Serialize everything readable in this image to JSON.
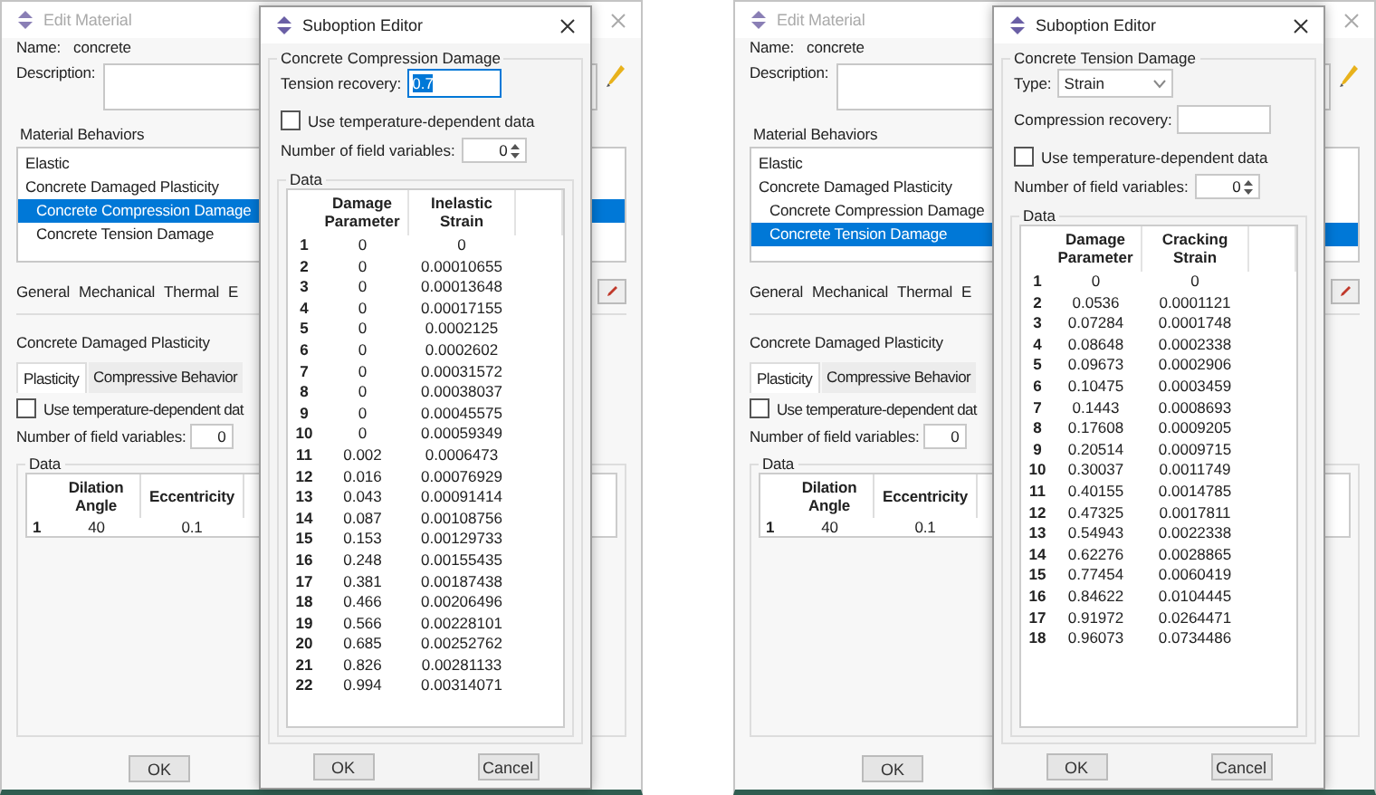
{
  "panels": [
    {
      "edit_material": {
        "title": "Edit Material",
        "name_label": "Name:",
        "name": "concrete",
        "description_label": "Description:",
        "behaviors_label": "Material Behaviors",
        "behaviors": [
          {
            "label": "Elastic",
            "selected": false
          },
          {
            "label": "Concrete Damaged Plasticity",
            "selected": false,
            "children": [
              {
                "label": "Concrete Compression Damage",
                "selected": true
              },
              {
                "label": "Concrete Tension Damage",
                "selected": false
              }
            ]
          }
        ],
        "menus": [
          "General",
          "Mechanical",
          "Thermal",
          "E"
        ],
        "section_title": "Concrete Damaged Plasticity",
        "tabs": [
          {
            "label": "Plasticity",
            "selected": true
          },
          {
            "label": "Compressive Behavior",
            "selected": false
          }
        ],
        "temp_dependent": {
          "label": "Use temperature-dependent dat",
          "checked": false
        },
        "field_vars": {
          "label": "Number of field variables:",
          "value": "0"
        },
        "data_label": "Data",
        "table": {
          "columns": [
            "",
            "Dilation Angle",
            "Eccentricity"
          ],
          "rows": [
            [
              "1",
              "40",
              "0.1"
            ]
          ]
        },
        "buttons": [
          "OK"
        ]
      },
      "suboption_editor": {
        "title": "Suboption Editor",
        "group_title": "Concrete Compression Damage",
        "fields": [
          {
            "kind": "input",
            "label": "Tension recovery:",
            "value": "0.7",
            "value_selected": true
          }
        ],
        "temp_dependent": {
          "label": "Use temperature-dependent data",
          "checked": false
        },
        "field_vars": {
          "label": "Number of field variables:",
          "value": "0"
        },
        "data_label": "Data",
        "table": {
          "columns": [
            "",
            "Damage Parameter",
            "Inelastic Strain"
          ],
          "rows": [
            [
              "1",
              "0",
              "0"
            ],
            [
              "2",
              "0",
              "0.00010655"
            ],
            [
              "3",
              "0",
              "0.00013648"
            ],
            [
              "4",
              "0",
              "0.00017155"
            ],
            [
              "5",
              "0",
              "0.0002125"
            ],
            [
              "6",
              "0",
              "0.0002602"
            ],
            [
              "7",
              "0",
              "0.00031572"
            ],
            [
              "8",
              "0",
              "0.00038037"
            ],
            [
              "9",
              "0",
              "0.00045575"
            ],
            [
              "10",
              "0",
              "0.00059349"
            ],
            [
              "11",
              "0.002",
              "0.0006473"
            ],
            [
              "12",
              "0.016",
              "0.00076929"
            ],
            [
              "13",
              "0.043",
              "0.00091414"
            ],
            [
              "14",
              "0.087",
              "0.00108756"
            ],
            [
              "15",
              "0.153",
              "0.00129733"
            ],
            [
              "16",
              "0.248",
              "0.00155435"
            ],
            [
              "17",
              "0.381",
              "0.00187438"
            ],
            [
              "18",
              "0.466",
              "0.00206496"
            ],
            [
              "19",
              "0.566",
              "0.00228101"
            ],
            [
              "20",
              "0.685",
              "0.00252762"
            ],
            [
              "21",
              "0.826",
              "0.00281133"
            ],
            [
              "22",
              "0.994",
              "0.00314071"
            ]
          ]
        },
        "buttons": [
          "OK",
          "Cancel"
        ]
      }
    },
    {
      "edit_material": {
        "title": "Edit Material",
        "name_label": "Name:",
        "name": "concrete",
        "description_label": "Description:",
        "behaviors_label": "Material Behaviors",
        "behaviors": [
          {
            "label": "Elastic",
            "selected": false
          },
          {
            "label": "Concrete Damaged Plasticity",
            "selected": false,
            "children": [
              {
                "label": "Concrete Compression Damage",
                "selected": false
              },
              {
                "label": "Concrete Tension Damage",
                "selected": true
              }
            ]
          }
        ],
        "menus": [
          "General",
          "Mechanical",
          "Thermal",
          "E"
        ],
        "section_title": "Concrete Damaged Plasticity",
        "tabs": [
          {
            "label": "Plasticity",
            "selected": true
          },
          {
            "label": "Compressive Behavior",
            "selected": false
          }
        ],
        "temp_dependent": {
          "label": "Use temperature-dependent dat",
          "checked": false
        },
        "field_vars": {
          "label": "Number of field variables:",
          "value": "0"
        },
        "data_label": "Data",
        "table": {
          "columns": [
            "",
            "Dilation Angle",
            "Eccentricity"
          ],
          "rows": [
            [
              "1",
              "40",
              "0.1"
            ]
          ]
        },
        "buttons": [
          "OK"
        ]
      },
      "suboption_editor": {
        "title": "Suboption Editor",
        "group_title": "Concrete Tension Damage",
        "fields": [
          {
            "kind": "select",
            "label": "Type:",
            "value": "Strain"
          },
          {
            "kind": "input",
            "label": "Compression recovery:"
          }
        ],
        "temp_dependent": {
          "label": "Use temperature-dependent data",
          "checked": false
        },
        "field_vars": {
          "label": "Number of field variables:",
          "value": "0"
        },
        "data_label": "Data",
        "table": {
          "columns": [
            "",
            "Damage Parameter",
            "Cracking Strain"
          ],
          "rows": [
            [
              "1",
              "0",
              "0"
            ],
            [
              "2",
              "0.0536",
              "0.0001121"
            ],
            [
              "3",
              "0.07284",
              "0.0001748"
            ],
            [
              "4",
              "0.08648",
              "0.0002338"
            ],
            [
              "5",
              "0.09673",
              "0.0002906"
            ],
            [
              "6",
              "0.10475",
              "0.0003459"
            ],
            [
              "7",
              "0.1443",
              "0.0008693"
            ],
            [
              "8",
              "0.17608",
              "0.0009205"
            ],
            [
              "9",
              "0.20514",
              "0.0009715"
            ],
            [
              "10",
              "0.30037",
              "0.0011749"
            ],
            [
              "11",
              "0.40155",
              "0.0014785"
            ],
            [
              "12",
              "0.47325",
              "0.0017811"
            ],
            [
              "13",
              "0.54943",
              "0.0022338"
            ],
            [
              "14",
              "0.62276",
              "0.0028865"
            ],
            [
              "15",
              "0.77454",
              "0.0060419"
            ],
            [
              "16",
              "0.84622",
              "0.0104445"
            ],
            [
              "17",
              "0.91972",
              "0.0264471"
            ],
            [
              "18",
              "0.96073",
              "0.0734486"
            ]
          ]
        },
        "buttons": [
          "OK",
          "Cancel"
        ]
      }
    }
  ]
}
